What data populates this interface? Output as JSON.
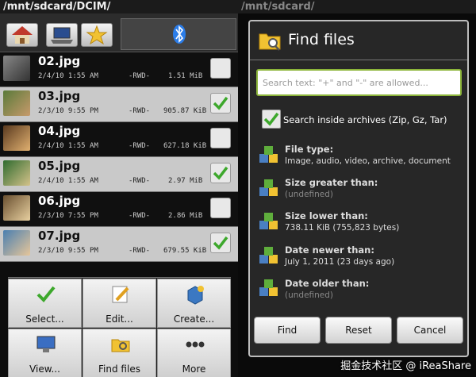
{
  "left": {
    "path": "/mnt/sdcard/DCIM/",
    "files": [
      {
        "name": "02.jpg",
        "date": "2/4/10 1:55 AM",
        "attrs": "-RWD-",
        "size": "1.51 MiB",
        "checked": false
      },
      {
        "name": "03.jpg",
        "date": "2/3/10 9:55 PM",
        "attrs": "-RWD-",
        "size": "905.87 KiB",
        "checked": true
      },
      {
        "name": "04.jpg",
        "date": "2/4/10 1:55 AM",
        "attrs": "-RWD-",
        "size": "627.18 KiB",
        "checked": false
      },
      {
        "name": "05.jpg",
        "date": "2/4/10 1:55 AM",
        "attrs": "-RWD-",
        "size": "2.97 MiB",
        "checked": true
      },
      {
        "name": "06.jpg",
        "date": "2/3/10 7:55 PM",
        "attrs": "-RWD-",
        "size": "2.86 MiB",
        "checked": false
      },
      {
        "name": "07.jpg",
        "date": "2/3/10 9:55 PM",
        "attrs": "-RWD-",
        "size": "679.55 KiB",
        "checked": true
      }
    ],
    "menu": [
      "Select...",
      "Edit...",
      "Create...",
      "View...",
      "Find files",
      "More"
    ]
  },
  "right": {
    "path": "/mnt/sdcard/",
    "dialog": {
      "title": "Find files",
      "search_placeholder": "Search text: \"+\" and \"-\" are allowed...",
      "archive_label": "Search inside archives (Zip, Gz, Tar)",
      "options": [
        {
          "title": "File type:",
          "value": "Image, audio, video, archive, document",
          "muted": false
        },
        {
          "title": "Size greater than:",
          "value": "(undefined)",
          "muted": true
        },
        {
          "title": "Size lower than:",
          "value": "738.11 KiB (755,823 bytes)",
          "muted": false
        },
        {
          "title": "Date newer than:",
          "value": "July 1, 2011 (23 days ago)",
          "muted": false
        },
        {
          "title": "Date older than:",
          "value": "(undefined)",
          "muted": true
        }
      ],
      "buttons": {
        "find": "Find",
        "reset": "Reset",
        "cancel": "Cancel"
      }
    },
    "watermark": "掘金技术社区 @ iReaShare"
  },
  "colors": {
    "accent_green": "#8cb53a",
    "check_green": "#3da82c",
    "selected_row": "#c9c9c9"
  }
}
